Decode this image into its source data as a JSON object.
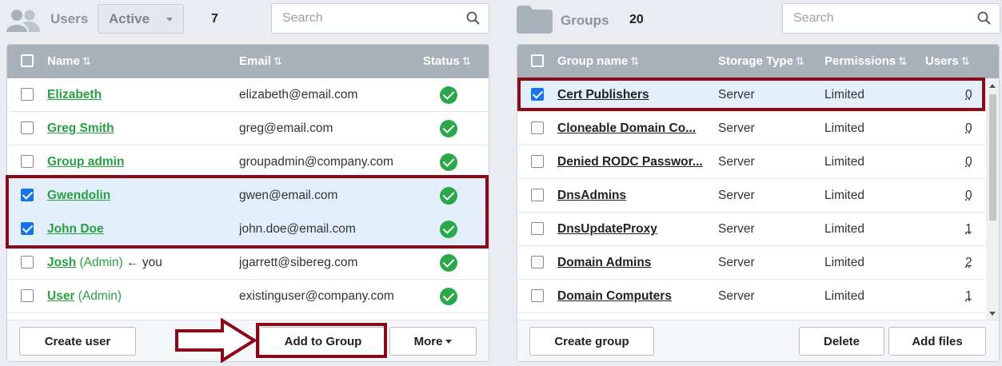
{
  "users": {
    "title": "Users",
    "filter": "Active",
    "count": "7",
    "search_placeholder": "Search",
    "columns": {
      "name": "Name",
      "email": "Email",
      "status": "Status",
      "sort_glyph": "⇅"
    },
    "rows": [
      {
        "name": "Elizabeth",
        "admin": "",
        "you": "",
        "email": "elizabeth@email.com",
        "checked": false
      },
      {
        "name": "Greg Smith",
        "admin": "",
        "you": "",
        "email": "greg@email.com",
        "checked": false
      },
      {
        "name": "Group admin",
        "admin": "",
        "you": "",
        "email": "groupadmin@company.com",
        "checked": false
      },
      {
        "name": "Gwendolin",
        "admin": "",
        "you": "",
        "email": "gwen@email.com",
        "checked": true
      },
      {
        "name": "John Doe",
        "admin": "",
        "you": "",
        "email": "john.doe@email.com",
        "checked": true
      },
      {
        "name": "Josh",
        "admin": "(Admin)",
        "you": "← you",
        "email": "jgarrett@sibereg.com",
        "checked": false
      },
      {
        "name": "User",
        "admin": "(Admin)",
        "you": "",
        "email": "existinguser@company.com",
        "checked": false
      }
    ],
    "buttons": {
      "create": "Create user",
      "add_to_group": "Add to Group",
      "more": "More"
    }
  },
  "groups": {
    "title": "Groups",
    "count": "20",
    "search_placeholder": "Search",
    "columns": {
      "name": "Group name",
      "storage": "Storage Type",
      "permissions": "Permissions",
      "users": "Users"
    },
    "rows": [
      {
        "name": "Cert Publishers",
        "storage": "Server",
        "permissions": "Limited",
        "users": "0",
        "checked": true
      },
      {
        "name": "Cloneable Domain Co...",
        "storage": "Server",
        "permissions": "Limited",
        "users": "0",
        "checked": false
      },
      {
        "name": "Denied RODC Passwor...",
        "storage": "Server",
        "permissions": "Limited",
        "users": "0",
        "checked": false
      },
      {
        "name": "DnsAdmins",
        "storage": "Server",
        "permissions": "Limited",
        "users": "0",
        "checked": false
      },
      {
        "name": "DnsUpdateProxy",
        "storage": "Server",
        "permissions": "Limited",
        "users": "1",
        "checked": false
      },
      {
        "name": "Domain Admins",
        "storage": "Server",
        "permissions": "Limited",
        "users": "2",
        "checked": false
      },
      {
        "name": "Domain Computers",
        "storage": "Server",
        "permissions": "Limited",
        "users": "1",
        "checked": false
      }
    ],
    "buttons": {
      "create": "Create group",
      "delete": "Delete",
      "add_files": "Add files"
    }
  },
  "colors": {
    "highlight": "#8b0a1a",
    "link_green": "#27a242",
    "header_gray": "#a9b2bb",
    "checkbox_blue": "#1a73e8"
  }
}
